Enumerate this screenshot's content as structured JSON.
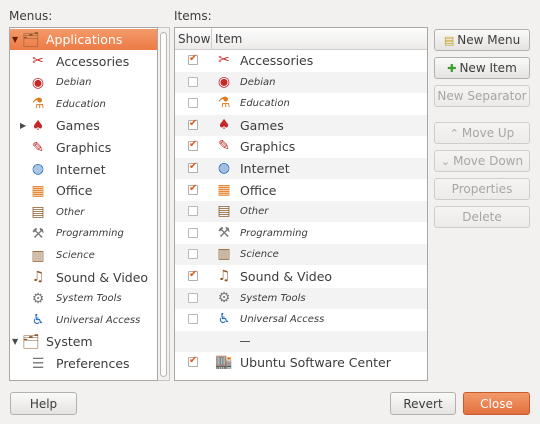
{
  "labels": {
    "menus": "Menus:",
    "items": "Items:"
  },
  "menus_tree": [
    {
      "label": "Applications",
      "level": 0,
      "expanded": true,
      "selected": true,
      "icon": "applications-icon",
      "glyph": "🗂",
      "style": "normal",
      "color": "ic-brown"
    },
    {
      "label": "Accessories",
      "level": 1,
      "icon": "accessories-icon",
      "glyph": "✂",
      "style": "normal",
      "color": "ic-red"
    },
    {
      "label": "Debian",
      "level": 1,
      "icon": "debian-icon",
      "glyph": "◉",
      "style": "small",
      "color": "ic-red"
    },
    {
      "label": "Education",
      "level": 1,
      "icon": "education-icon",
      "glyph": "⚗",
      "style": "small",
      "color": "ic-orange"
    },
    {
      "label": "Games",
      "level": 1,
      "collapsed": true,
      "icon": "games-icon",
      "glyph": "♠",
      "style": "normal",
      "color": "ic-red"
    },
    {
      "label": "Graphics",
      "level": 1,
      "icon": "graphics-icon",
      "glyph": "✎",
      "style": "normal",
      "color": "ic-red"
    },
    {
      "label": "Internet",
      "level": 1,
      "icon": "internet-icon",
      "glyph": "◍",
      "style": "normal",
      "color": "ic-blue"
    },
    {
      "label": "Office",
      "level": 1,
      "icon": "office-icon",
      "glyph": "▦",
      "style": "normal",
      "color": "ic-orange"
    },
    {
      "label": "Other",
      "level": 1,
      "icon": "other-icon",
      "glyph": "▤",
      "style": "small",
      "color": "ic-brown"
    },
    {
      "label": "Programming",
      "level": 1,
      "icon": "programming-icon",
      "glyph": "⚒",
      "style": "small",
      "color": "ic-grey"
    },
    {
      "label": "Science",
      "level": 1,
      "icon": "science-icon",
      "glyph": "▥",
      "style": "small",
      "color": "ic-brown"
    },
    {
      "label": "Sound & Video",
      "level": 1,
      "icon": "sound-video-icon",
      "glyph": "♫",
      "style": "normal",
      "color": "ic-brown"
    },
    {
      "label": "System Tools",
      "level": 1,
      "icon": "system-tools-icon",
      "glyph": "⚙",
      "style": "small",
      "color": "ic-grey"
    },
    {
      "label": "Universal Access",
      "level": 1,
      "icon": "universal-access-icon",
      "glyph": "♿",
      "style": "small",
      "color": "ic-blue"
    },
    {
      "label": "System",
      "level": 0,
      "expanded": true,
      "icon": "system-icon",
      "glyph": "🗂",
      "style": "normal",
      "color": "ic-brown"
    },
    {
      "label": "Preferences",
      "level": 1,
      "icon": "preferences-icon",
      "glyph": "☰",
      "style": "normal",
      "color": "ic-grey"
    }
  ],
  "items_header": {
    "show": "Show",
    "item": "Item"
  },
  "items": [
    {
      "label": "Accessories",
      "show": true,
      "icon": "accessories-icon",
      "glyph": "✂",
      "style": "normal",
      "color": "ic-red"
    },
    {
      "label": "Debian",
      "show": false,
      "icon": "debian-icon",
      "glyph": "◉",
      "style": "small",
      "color": "ic-red"
    },
    {
      "label": "Education",
      "show": false,
      "icon": "education-icon",
      "glyph": "⚗",
      "style": "small",
      "color": "ic-orange"
    },
    {
      "label": "Games",
      "show": true,
      "icon": "games-icon",
      "glyph": "♠",
      "style": "normal",
      "color": "ic-red"
    },
    {
      "label": "Graphics",
      "show": true,
      "icon": "graphics-icon",
      "glyph": "✎",
      "style": "normal",
      "color": "ic-red"
    },
    {
      "label": "Internet",
      "show": true,
      "icon": "internet-icon",
      "glyph": "◍",
      "style": "normal",
      "color": "ic-blue"
    },
    {
      "label": "Office",
      "show": true,
      "icon": "office-icon",
      "glyph": "▦",
      "style": "normal",
      "color": "ic-orange"
    },
    {
      "label": "Other",
      "show": false,
      "icon": "other-icon",
      "glyph": "▤",
      "style": "small",
      "color": "ic-brown"
    },
    {
      "label": "Programming",
      "show": false,
      "icon": "programming-icon",
      "glyph": "⚒",
      "style": "small",
      "color": "ic-grey"
    },
    {
      "label": "Science",
      "show": false,
      "icon": "science-icon",
      "glyph": "▥",
      "style": "small",
      "color": "ic-brown"
    },
    {
      "label": "Sound & Video",
      "show": true,
      "icon": "sound-video-icon",
      "glyph": "♫",
      "style": "normal",
      "color": "ic-brown"
    },
    {
      "label": "System Tools",
      "show": false,
      "icon": "system-tools-icon",
      "glyph": "⚙",
      "style": "small",
      "color": "ic-grey"
    },
    {
      "label": "Universal Access",
      "show": false,
      "icon": "universal-access-icon",
      "glyph": "♿",
      "style": "small",
      "color": "ic-blue"
    },
    {
      "label": "",
      "separator": true
    },
    {
      "label": "Ubuntu Software Center",
      "show": true,
      "icon": "software-center-icon",
      "glyph": "🏬",
      "style": "normal",
      "color": "ic-green"
    }
  ],
  "buttons": {
    "new_menu": "New Menu",
    "new_item": "New Item",
    "new_separator": "New Separator",
    "move_up": "Move Up",
    "move_down": "Move Down",
    "properties": "Properties",
    "delete": "Delete",
    "help": "Help",
    "revert": "Revert",
    "close": "Close"
  }
}
